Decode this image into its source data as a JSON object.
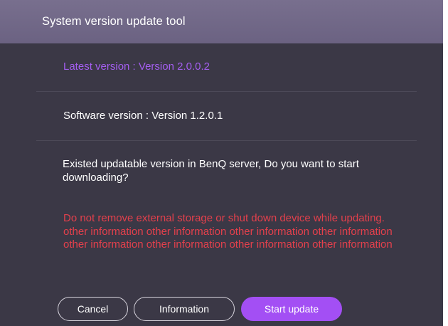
{
  "dialog": {
    "title": "System version update tool",
    "latest_version": "Latest version : Version  2.0.0.2",
    "software_version": "Software version : Version 1.2.0.1",
    "question": "Existed updatable version in BenQ server, Do you want to start downloading?",
    "warning": "Do not remove external storage or shut down device while updating. other information other information other information other information other information other information other information other information"
  },
  "buttons": {
    "cancel": "Cancel",
    "information": "Information",
    "start_update": "Start update"
  },
  "colors": {
    "background": "#3b3846",
    "titlebar": "#736a89",
    "accent": "#a34ff4",
    "warning": "#e3404c"
  }
}
